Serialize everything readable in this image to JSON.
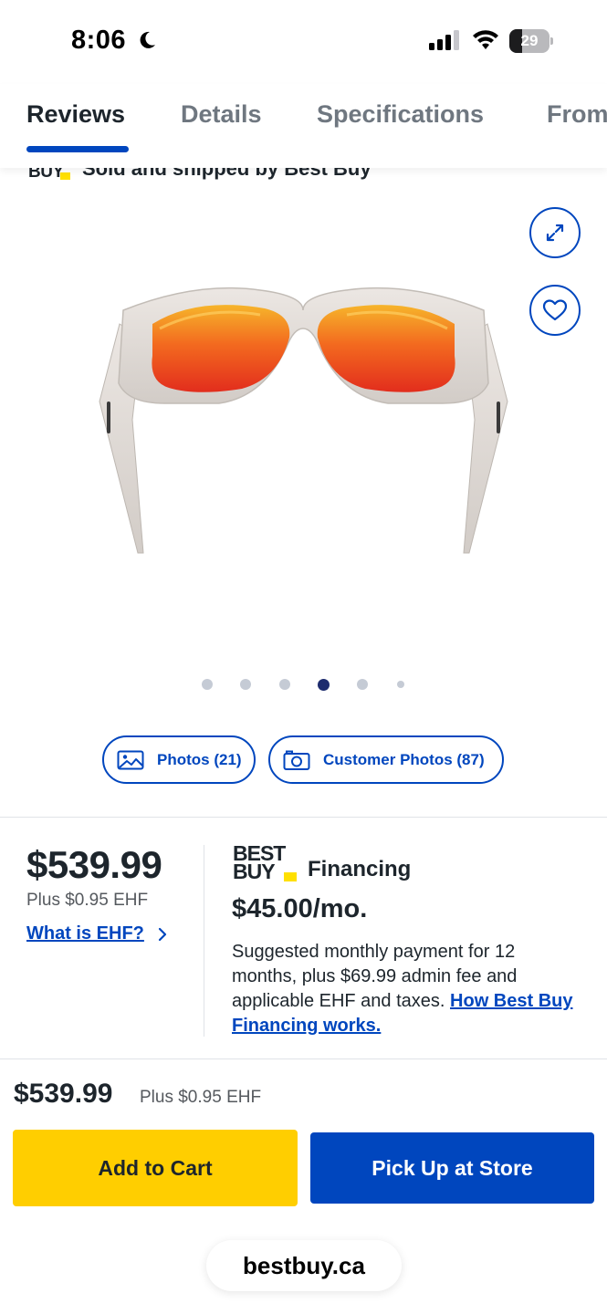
{
  "status_bar": {
    "time": "8:06",
    "battery": "29",
    "icons": [
      "moon-icon",
      "signal-icon",
      "wifi-icon",
      "battery-icon"
    ]
  },
  "tabs": [
    {
      "label": "Reviews",
      "active": true
    },
    {
      "label": "Details",
      "active": false
    },
    {
      "label": "Specifications",
      "active": false
    },
    {
      "label": "From",
      "active": false
    }
  ],
  "seller": {
    "logo": "BUY",
    "text": "Sold and shipped by Best Buy"
  },
  "gallery": {
    "icons": [
      "expand-icon",
      "heart-icon"
    ],
    "dot_count": 6,
    "active_dot_index": 3,
    "photos_label": "Photos (21)",
    "customer_photos_label": "Customer Photos (87)"
  },
  "price": {
    "main": "$539.99",
    "ehf": "Plus $0.95 EHF",
    "ehf_link": "What is EHF?"
  },
  "financing": {
    "logo_line1": "BEST",
    "logo_line2": "BUY",
    "label": "Financing",
    "amount": "$45.00/mo.",
    "description": "Suggested monthly payment for 12 months, plus $69.99 admin fee and applicable EHF and taxes.",
    "link": "How Best Buy Financing works."
  },
  "bottom_bar": {
    "price": "$539.99",
    "ehf": "Plus $0.95 EHF",
    "add_to_cart": "Add to Cart",
    "pick_up": "Pick Up at Store"
  },
  "browser": {
    "url": "bestbuy.ca"
  },
  "colors": {
    "brand_blue": "#0046be",
    "cart_yellow": "#ffce00",
    "tag_yellow": "#ffe000",
    "text_dark": "#1d252c"
  }
}
